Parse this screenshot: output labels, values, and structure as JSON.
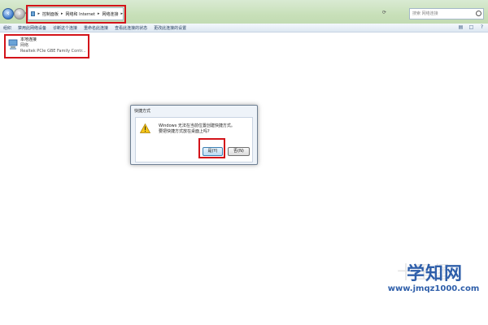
{
  "address_bar": {
    "breadcrumbs": [
      "控制面板",
      "网络和 Internet",
      "网络连接"
    ],
    "refresh_icon": "refresh-icon",
    "search_placeholder": "搜索 网络连接"
  },
  "toolbar": {
    "items": [
      "组织",
      "禁用此网络设备",
      "诊断这个连接",
      "重命名此连接",
      "查看此连接的状态",
      "更改此连接的设置"
    ],
    "right_icons": [
      "view-options-icon",
      "preview-pane-icon",
      "help-icon"
    ]
  },
  "connection": {
    "name": "本地连接",
    "network": "网络",
    "adapter": "Realtek PCIe GBE Family Contr..."
  },
  "dialog": {
    "title": "快捷方式",
    "message_line1": "Windows 无法在当前位置创建快捷方式。",
    "message_line2": "要把快捷方式放在桌面上吗?",
    "yes_label": "是(Y)",
    "no_label": "否(N)"
  },
  "watermark": {
    "text": "学知网",
    "url": "www.jmqz1000.com",
    "faint": "十里堡"
  },
  "colors": {
    "highlight_box": "#d3131a",
    "watermark": "#2f5faa"
  }
}
